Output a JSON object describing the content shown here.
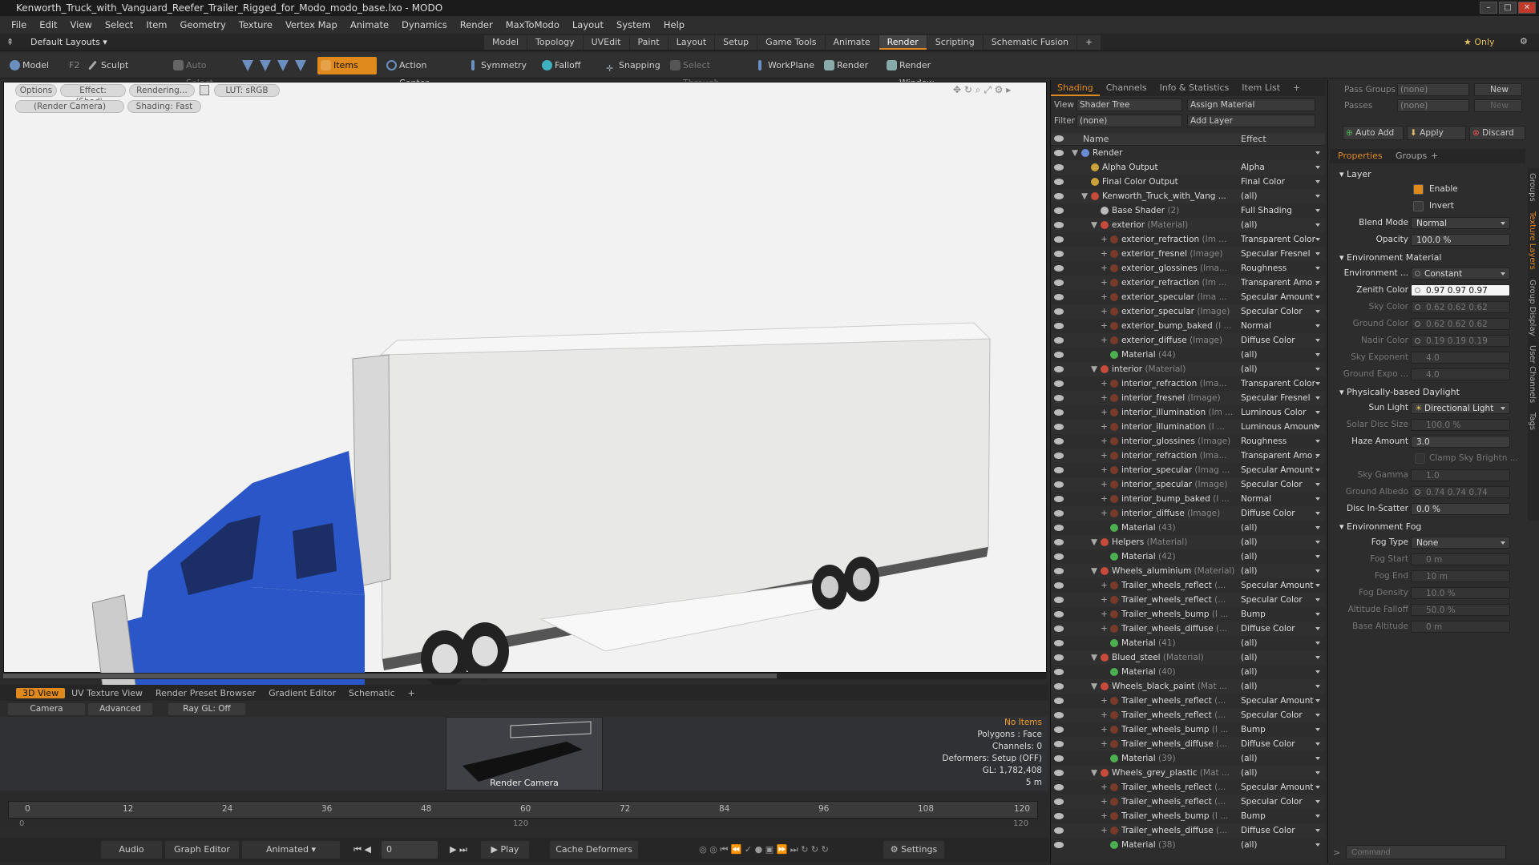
{
  "window": {
    "title": "Kenworth_Truck_with_Vanguard_Reefer_Trailer_Rigged_for_Modo_modo_base.lxo - MODO"
  },
  "menu": [
    "File",
    "Edit",
    "View",
    "Select",
    "Item",
    "Geometry",
    "Texture",
    "Vertex Map",
    "Animate",
    "Dynamics",
    "Render",
    "MaxToModo",
    "Layout",
    "System",
    "Help"
  ],
  "layout": {
    "preset": "Default Layouts ▾",
    "tabs": [
      "Model",
      "Topology",
      "UVEdit",
      "Paint",
      "Layout",
      "Setup",
      "Game Tools",
      "Animate",
      "Render",
      "Scripting",
      "Schematic Fusion",
      "+"
    ],
    "active_tab": "Render",
    "only": "★ Only"
  },
  "toolbar": {
    "model": "Model",
    "model_key": "F2",
    "sculpt": "Sculpt",
    "auto_select": "Auto Select",
    "items": "Items",
    "action_center": "Action Center",
    "symmetry": "Symmetry",
    "falloff": "Falloff",
    "snapping": "Snapping",
    "select_through": "Select Through",
    "workplane": "WorkPlane",
    "render": "Render",
    "render_window": "Render Window"
  },
  "viewport": {
    "buttons": [
      "Options",
      "Effect: (Shadi...",
      "Rendering...",
      "LUT: sRGB",
      "(Render Camera)",
      "Shading: Fast"
    ]
  },
  "bottom": {
    "tabs": [
      "3D View",
      "UV Texture View",
      "Render Preset Browser",
      "Gradient Editor",
      "Schematic",
      "+"
    ],
    "active_tab": "3D View",
    "cam_buttons": [
      "Camera",
      "Advanced",
      "Ray GL: Off"
    ],
    "thumb_label": "Render Camera",
    "stats": [
      "No Items",
      "Polygons : Face",
      "Channels: 0",
      "Deformers: Setup (OFF)",
      "GL: 1,782,408",
      "5 m"
    ]
  },
  "timeline": {
    "ticks": [
      "0",
      "12",
      "24",
      "36",
      "48",
      "60",
      "72",
      "84",
      "96",
      "108",
      "120"
    ],
    "ticks_bottom": [
      "0",
      "120",
      "120"
    ]
  },
  "transport": {
    "audio": "Audio",
    "graph_editor": "Graph Editor",
    "animated": "Animated",
    "frame": "0",
    "play": "Play",
    "cache_deformers": "Cache Deformers",
    "settings": "Settings"
  },
  "shader": {
    "tabs": [
      "Shading",
      "Channels",
      "Info & Statistics",
      "Item List",
      "+"
    ],
    "active_tab": "Shading",
    "view_label": "View",
    "view_value": "Shader Tree",
    "assign_material": "Assign Material",
    "filter_label": "Filter",
    "filter_value": "(none)",
    "add_layer": "Add Layer",
    "col_name": "Name",
    "col_effect": "Effect",
    "rows": [
      {
        "indent": 0,
        "name": "Render",
        "type": "",
        "effect": "",
        "sw": "#6a8cd6",
        "exp": "▼"
      },
      {
        "indent": 1,
        "name": "Alpha Output",
        "type": "",
        "effect": "Alpha",
        "sw": "#c9a23a",
        "exp": ""
      },
      {
        "indent": 1,
        "name": "Final Color Output",
        "type": "",
        "effect": "Final Color",
        "sw": "#c9a23a",
        "exp": ""
      },
      {
        "indent": 1,
        "name": "Kenworth_Truck_with_Vang ...",
        "type": "",
        "effect": "(all)",
        "sw": "#c84a3a",
        "exp": "▼"
      },
      {
        "indent": 2,
        "name": "Base Shader",
        "type": " (2)",
        "effect": "Full Shading",
        "sw": "#bbbbbb",
        "exp": ""
      },
      {
        "indent": 2,
        "name": "exterior",
        "type": " (Material)",
        "effect": "(all)",
        "sw": "#c84a3a",
        "exp": "▼"
      },
      {
        "indent": 3,
        "name": "exterior_refraction",
        "type": " (Im ...",
        "effect": "Transparent Color",
        "sw": "#7a3a2a",
        "exp": "+"
      },
      {
        "indent": 3,
        "name": "exterior_fresnel",
        "type": " (Image)",
        "effect": "Specular Fresnel",
        "sw": "#7a3a2a",
        "exp": "+"
      },
      {
        "indent": 3,
        "name": "exterior_glossines",
        "type": " (Ima...",
        "effect": "Roughness",
        "sw": "#7a3a2a",
        "exp": "+"
      },
      {
        "indent": 3,
        "name": "exterior_refraction",
        "type": " (Im ...",
        "effect": "Transparent Amo ...",
        "sw": "#7a3a2a",
        "exp": "+"
      },
      {
        "indent": 3,
        "name": "exterior_specular",
        "type": " (Ima ...",
        "effect": "Specular Amount",
        "sw": "#7a3a2a",
        "exp": "+"
      },
      {
        "indent": 3,
        "name": "exterior_specular",
        "type": " (Image)",
        "effect": "Specular Color",
        "sw": "#7a3a2a",
        "exp": "+"
      },
      {
        "indent": 3,
        "name": "exterior_bump_baked",
        "type": " (I ...",
        "effect": "Normal",
        "sw": "#7a3a2a",
        "exp": "+"
      },
      {
        "indent": 3,
        "name": "exterior_diffuse",
        "type": " (Image)",
        "effect": "Diffuse Color",
        "sw": "#7a3a2a",
        "exp": "+"
      },
      {
        "indent": 3,
        "name": "Material",
        "type": " (44)",
        "effect": "(all)",
        "sw": "#4caf50",
        "exp": ""
      },
      {
        "indent": 2,
        "name": "interior",
        "type": " (Material)",
        "effect": "(all)",
        "sw": "#c84a3a",
        "exp": "▼"
      },
      {
        "indent": 3,
        "name": "interior_refraction",
        "type": " (Ima...",
        "effect": "Transparent Color",
        "sw": "#7a3a2a",
        "exp": "+"
      },
      {
        "indent": 3,
        "name": "interior_fresnel",
        "type": " (Image)",
        "effect": "Specular Fresnel",
        "sw": "#7a3a2a",
        "exp": "+"
      },
      {
        "indent": 3,
        "name": "interior_illumination",
        "type": " (Im ...",
        "effect": "Luminous Color",
        "sw": "#7a3a2a",
        "exp": "+"
      },
      {
        "indent": 3,
        "name": "interior_illumination",
        "type": " (I ...",
        "effect": "Luminous Amount",
        "sw": "#7a3a2a",
        "exp": "+"
      },
      {
        "indent": 3,
        "name": "interior_glossines",
        "type": " (Image)",
        "effect": "Roughness",
        "sw": "#7a3a2a",
        "exp": "+"
      },
      {
        "indent": 3,
        "name": "interior_refraction",
        "type": " (Ima...",
        "effect": "Transparent Amo ...",
        "sw": "#7a3a2a",
        "exp": "+"
      },
      {
        "indent": 3,
        "name": "interior_specular",
        "type": " (Imag ...",
        "effect": "Specular Amount",
        "sw": "#7a3a2a",
        "exp": "+"
      },
      {
        "indent": 3,
        "name": "interior_specular",
        "type": " (Image)",
        "effect": "Specular Color",
        "sw": "#7a3a2a",
        "exp": "+"
      },
      {
        "indent": 3,
        "name": "interior_bump_baked",
        "type": " (I ...",
        "effect": "Normal",
        "sw": "#7a3a2a",
        "exp": "+"
      },
      {
        "indent": 3,
        "name": "interior_diffuse",
        "type": " (Image)",
        "effect": "Diffuse Color",
        "sw": "#7a3a2a",
        "exp": "+"
      },
      {
        "indent": 3,
        "name": "Material",
        "type": " (43)",
        "effect": "(all)",
        "sw": "#4caf50",
        "exp": ""
      },
      {
        "indent": 2,
        "name": "Helpers",
        "type": " (Material)",
        "effect": "(all)",
        "sw": "#c84a3a",
        "exp": "▼"
      },
      {
        "indent": 3,
        "name": "Material",
        "type": " (42)",
        "effect": "(all)",
        "sw": "#4caf50",
        "exp": ""
      },
      {
        "indent": 2,
        "name": "Wheels_aluminium",
        "type": " (Material)",
        "effect": "(all)",
        "sw": "#c84a3a",
        "exp": "▼"
      },
      {
        "indent": 3,
        "name": "Trailer_wheels_reflect",
        "type": " (...",
        "effect": "Specular Amount",
        "sw": "#7a3a2a",
        "exp": "+"
      },
      {
        "indent": 3,
        "name": "Trailer_wheels_reflect",
        "type": " (...",
        "effect": "Specular Color",
        "sw": "#7a3a2a",
        "exp": "+"
      },
      {
        "indent": 3,
        "name": "Trailer_wheels_bump",
        "type": " (I ...",
        "effect": "Bump",
        "sw": "#7a3a2a",
        "exp": "+"
      },
      {
        "indent": 3,
        "name": "Trailer_wheels_diffuse",
        "type": " (...",
        "effect": "Diffuse Color",
        "sw": "#7a3a2a",
        "exp": "+"
      },
      {
        "indent": 3,
        "name": "Material",
        "type": " (41)",
        "effect": "(all)",
        "sw": "#4caf50",
        "exp": ""
      },
      {
        "indent": 2,
        "name": "Blued_steel",
        "type": " (Material)",
        "effect": "(all)",
        "sw": "#c84a3a",
        "exp": "▼"
      },
      {
        "indent": 3,
        "name": "Material",
        "type": " (40)",
        "effect": "(all)",
        "sw": "#4caf50",
        "exp": ""
      },
      {
        "indent": 2,
        "name": "Wheels_black_paint",
        "type": " (Mat ...",
        "effect": "(all)",
        "sw": "#c84a3a",
        "exp": "▼"
      },
      {
        "indent": 3,
        "name": "Trailer_wheels_reflect",
        "type": " (...",
        "effect": "Specular Amount",
        "sw": "#7a3a2a",
        "exp": "+"
      },
      {
        "indent": 3,
        "name": "Trailer_wheels_reflect",
        "type": " (...",
        "effect": "Specular Color",
        "sw": "#7a3a2a",
        "exp": "+"
      },
      {
        "indent": 3,
        "name": "Trailer_wheels_bump",
        "type": " (I ...",
        "effect": "Bump",
        "sw": "#7a3a2a",
        "exp": "+"
      },
      {
        "indent": 3,
        "name": "Trailer_wheels_diffuse",
        "type": " (...",
        "effect": "Diffuse Color",
        "sw": "#7a3a2a",
        "exp": "+"
      },
      {
        "indent": 3,
        "name": "Material",
        "type": " (39)",
        "effect": "(all)",
        "sw": "#4caf50",
        "exp": ""
      },
      {
        "indent": 2,
        "name": "Wheels_grey_plastic",
        "type": " (Mat ...",
        "effect": "(all)",
        "sw": "#c84a3a",
        "exp": "▼"
      },
      {
        "indent": 3,
        "name": "Trailer_wheels_reflect",
        "type": " (...",
        "effect": "Specular Amount",
        "sw": "#7a3a2a",
        "exp": "+"
      },
      {
        "indent": 3,
        "name": "Trailer_wheels_reflect",
        "type": " (...",
        "effect": "Specular Color",
        "sw": "#7a3a2a",
        "exp": "+"
      },
      {
        "indent": 3,
        "name": "Trailer_wheels_bump",
        "type": " (I ...",
        "effect": "Bump",
        "sw": "#7a3a2a",
        "exp": "+"
      },
      {
        "indent": 3,
        "name": "Trailer_wheels_diffuse",
        "type": " (...",
        "effect": "Diffuse Color",
        "sw": "#7a3a2a",
        "exp": "+"
      },
      {
        "indent": 3,
        "name": "Material",
        "type": " (38)",
        "effect": "(all)",
        "sw": "#4caf50",
        "exp": ""
      }
    ]
  },
  "props": {
    "pass_groups_label": "Pass Groups",
    "pass_groups_value": "(none)",
    "new": "New",
    "passes_label": "Passes",
    "passes_value": "(none)",
    "auto_add": "Auto Add",
    "apply": "Apply",
    "discard": "Discard",
    "tabs": [
      "Properties",
      "Groups",
      "+"
    ],
    "active_tab": "Properties",
    "side_tabs": [
      "Groups",
      "Texture Layers",
      "Group Display",
      "User Channels",
      "Tags"
    ],
    "layer_section": "Layer",
    "enable": "Enable",
    "invert": "Invert",
    "blend_mode_label": "Blend Mode",
    "blend_mode": "Normal",
    "opacity_label": "Opacity",
    "opacity": "100.0 %",
    "env_section": "Environment Material",
    "environment_label": "Environment ...",
    "environment": "Constant",
    "zenith_label": "Zenith Color",
    "zenith": "0.97   0.97   0.97",
    "sky_label": "Sky Color",
    "sky": "0.62   0.62   0.62",
    "ground_label": "Ground Color",
    "ground": "0.62   0.62   0.62",
    "nadir_label": "Nadir Color",
    "nadir": "0.19   0.19   0.19",
    "sky_exp_label": "Sky Exponent",
    "sky_exp": "4.0",
    "ground_exp_label": "Ground Expo ...",
    "ground_exp": "4.0",
    "daylight_section": "Physically-based Daylight",
    "sun_label": "Sun Light",
    "sun": "Directional Light",
    "solar_label": "Solar Disc Size",
    "solar": "100.0 %",
    "haze_label": "Haze Amount",
    "haze": "3.0",
    "clamp": "Clamp Sky Brightn ...",
    "sky_gamma_label": "Sky Gamma",
    "sky_gamma": "1.0",
    "albedo_label": "Ground Albedo",
    "albedo": "0.74   0.74   0.74",
    "disc_label": "Disc In-Scatter",
    "disc": "0.0 %",
    "fog_section": "Environment Fog",
    "fog_type_label": "Fog Type",
    "fog_type": "None",
    "fog_start_label": "Fog Start",
    "fog_start": "0 m",
    "fog_end_label": "Fog End",
    "fog_end": "10 m",
    "fog_density_label": "Fog Density",
    "fog_density": "10.0 %",
    "alt_falloff_label": "Altitude Falloff",
    "alt_falloff": "50.0 %",
    "base_alt_label": "Base Altitude",
    "base_alt": "0 m",
    "command_placeholder": "Command"
  }
}
